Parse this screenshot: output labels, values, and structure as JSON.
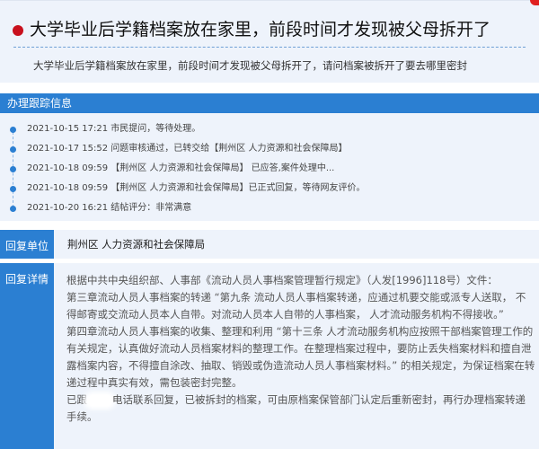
{
  "question": {
    "title": "大学毕业后学籍档案放在家里，前段时间才发现被父母拆开了",
    "description": "大学毕业后学籍档案放在家里，前段时间才发现被父母拆开了，请问档案被拆开了要去哪里密封"
  },
  "tracking": {
    "header": "办理跟踪信息",
    "items": [
      {
        "text": "2021-10-15 17:21 市民提问，等待处理。"
      },
      {
        "text": "2021-10-17 15:52 问题审核通过，已转交给【荆州区 人力资源和社会保障局】"
      },
      {
        "text": "2021-10-18 09:59 【荆州区 人力资源和社会保障局】 已应答,案件处理中..."
      },
      {
        "text": "2021-10-18 09:59 【荆州区 人力资源和社会保障局】已正式回复，等待网友评价。"
      },
      {
        "text": "2021-10-20 16:21 结帖评分：非常满意"
      }
    ]
  },
  "reply_unit": {
    "label": "回复单位",
    "value": "荆州区 人力资源和社会保障局"
  },
  "reply_detail": {
    "label": "回复详情",
    "lines": [
      "根据中共中央组织部、人事部《流动人员人事档案管理暂行规定》（人发[1996]118号）文件：",
      "第三章流动人员人事档案的转递 “第九条 流动人员人事档案转递，应通过机要交能或派专人送取， 不得邮寄或交流动人员本人自带。对流动人员本人自带的人事档案， 人才流动服务机构不得接收。”",
      "第四章流动人员人事档案的收集、整理和利用 “第十三条 人才流动服务机构应按照干部档案管理工作的有关规定，认真做好流动人员档案材料的整理工作。在整理档案过程中，要防止丢失档案材料和擅自泄露档案内容，不得擅自涂改、抽取、销毁或伪造流动人员人事档案材料。” 的相关规定，为保证档案在转递过程中真实有效，需包装密封完整。"
    ],
    "last_line_prefix": "已跟",
    "last_line_suffix": "电话联系回复，已被拆封的档案，可由原档案保管部门认定后重新密封，再行办理档案转递手续。"
  }
}
